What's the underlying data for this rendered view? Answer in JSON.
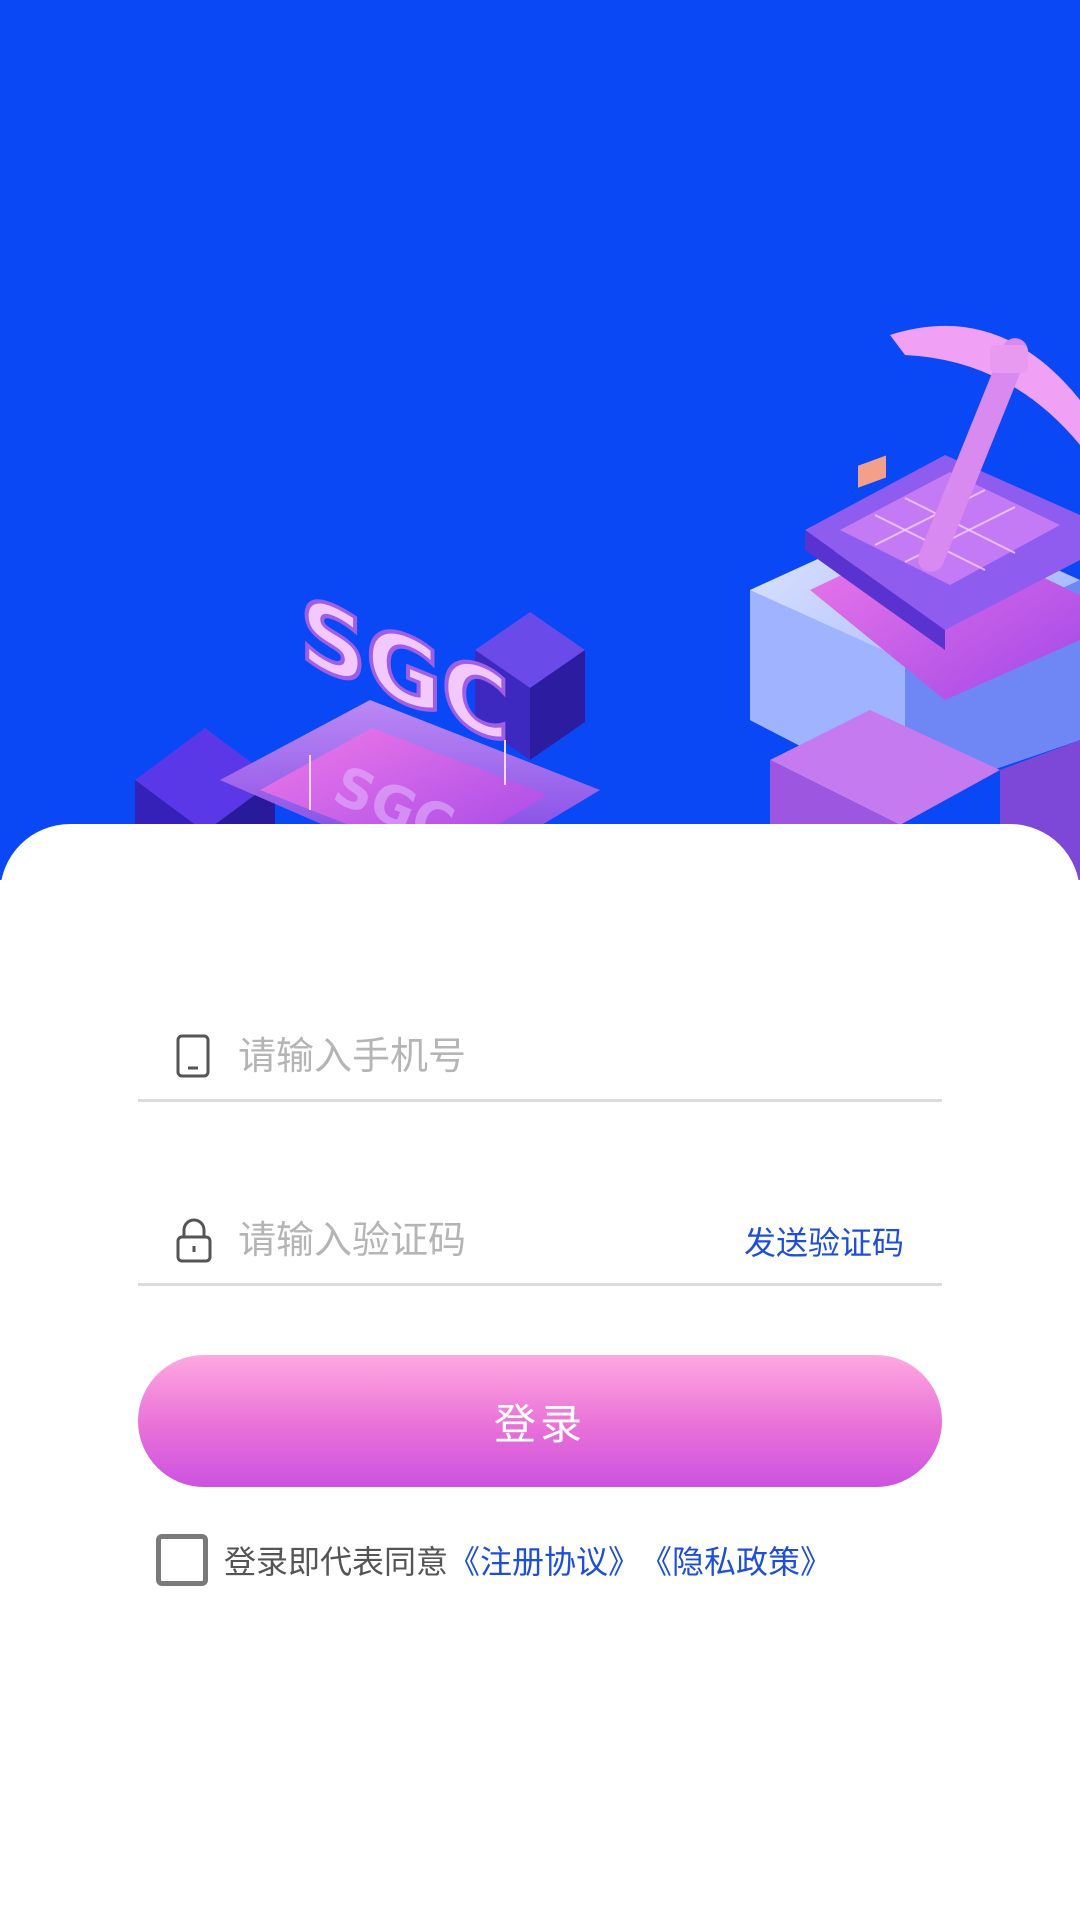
{
  "colors": {
    "hero_bg": "#0a48f5",
    "accent_link": "#1f4fd8",
    "button_gradient_top": "#ffa8e0",
    "button_gradient_bottom": "#cc52e0"
  },
  "hero": {
    "illustration": "isometric-mining-blocks-with-pickaxe",
    "logo_text": "SGC"
  },
  "form": {
    "phone": {
      "icon": "phone-icon",
      "placeholder": "请输入手机号",
      "value": ""
    },
    "code": {
      "icon": "lock-icon",
      "placeholder": "请输入验证码",
      "value": "",
      "send_label": "发送验证码"
    },
    "login_label": "登录",
    "agreement": {
      "checked": false,
      "prefix": "登录即代表同意",
      "terms_link": "《注册协议》",
      "privacy_link": "《隐私政策》"
    }
  }
}
